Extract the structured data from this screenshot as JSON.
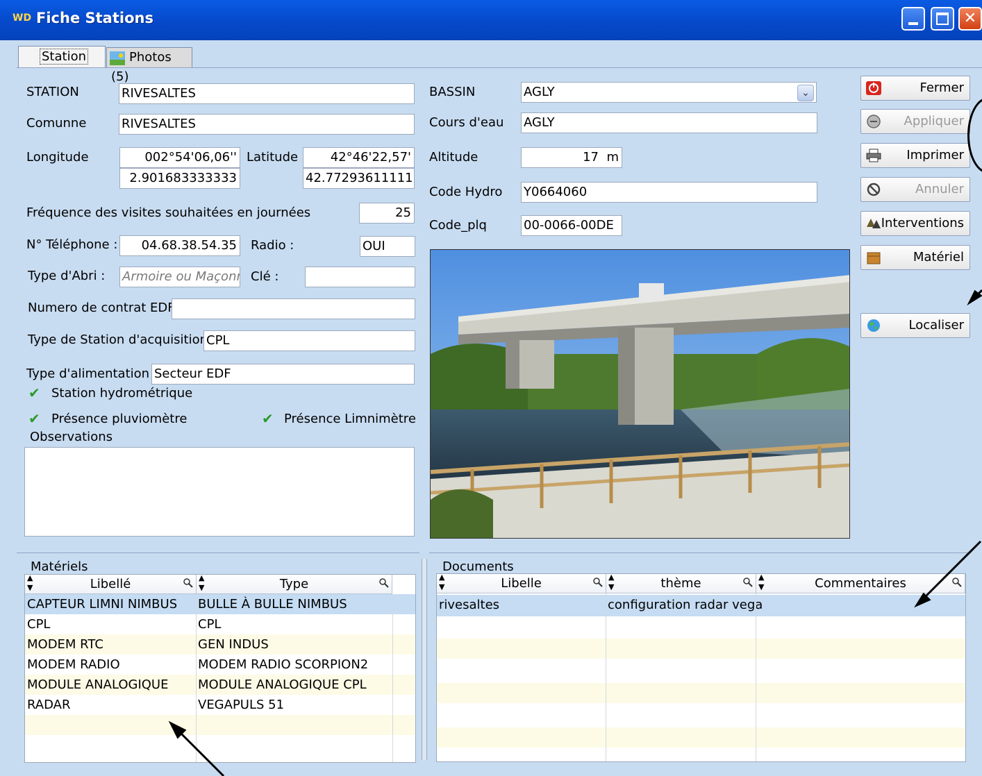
{
  "window": {
    "title": "Fiche Stations",
    "app_icon": "WD"
  },
  "tabs": [
    {
      "label": "Station"
    },
    {
      "label": "Photos (5)"
    }
  ],
  "form": {
    "station": {
      "label": "STATION",
      "value": "RIVESALTES"
    },
    "commune": {
      "label": "Comunne",
      "value": "RIVESALTES"
    },
    "longitude": {
      "label": "Longitude",
      "dms": "002°54'06,06''",
      "decimal": "2.901683333333"
    },
    "latitude": {
      "label": "Latitude",
      "dms": "42°46'22,57'",
      "decimal": "42.77293611111"
    },
    "frequence": {
      "label": "Fréquence des visites souhaitées en journées",
      "value": "25"
    },
    "telephone": {
      "label": "N° Téléphone :",
      "value": "04.68.38.54.35"
    },
    "radio": {
      "label": "Radio :",
      "value": "OUI"
    },
    "type_abri": {
      "label": "Type d'Abri :",
      "placeholder": "Armoire ou Maçonnerie"
    },
    "cle": {
      "label": "Clé :",
      "value": ""
    },
    "contrat_edf": {
      "label": "Numero de contrat EDF",
      "value": ""
    },
    "type_station": {
      "label": "Type de Station d'acquisition",
      "value": "CPL"
    },
    "type_alim": {
      "label": "Type d'alimentation :",
      "value": "Secteur EDF"
    },
    "checks": {
      "hydro": {
        "label": "Station hydrométrique",
        "checked": true
      },
      "pluvio": {
        "label": "Présence pluviomètre",
        "checked": true
      },
      "limni": {
        "label": "Présence Limnimètre",
        "checked": true
      }
    },
    "observations": {
      "label": "Observations",
      "value": ""
    },
    "bassin": {
      "label": "BASSIN",
      "value": "AGLY"
    },
    "cours_eau": {
      "label": "Cours d'eau",
      "value": "AGLY"
    },
    "altitude": {
      "label": "Altitude",
      "value": "17",
      "unit": "m"
    },
    "code_hydro": {
      "label": "Code Hydro",
      "value": "Y0664060"
    },
    "code_plq": {
      "label": "Code_plq",
      "value": "00-0066-00DE"
    }
  },
  "buttons": {
    "fermer": "Fermer",
    "appliquer": "Appliquer",
    "imprimer": "Imprimer",
    "annuler": "Annuler",
    "interventions": "Interventions",
    "materiel": "Matériel",
    "localiser": "Localiser"
  },
  "materiels": {
    "title": "Matériels",
    "columns": [
      "Libellé",
      "Type"
    ],
    "rows": [
      [
        "CAPTEUR LIMNI NIMBUS",
        "BULLE À BULLE NIMBUS"
      ],
      [
        "CPL",
        "CPL"
      ],
      [
        "MODEM RTC",
        "GEN INDUS"
      ],
      [
        "MODEM RADIO",
        "MODEM RADIO SCORPION2"
      ],
      [
        "MODULE ANALOGIQUE",
        "MODULE ANALOGIQUE CPL"
      ],
      [
        "RADAR",
        "VEGAPULS 51"
      ]
    ]
  },
  "documents": {
    "title": "Documents",
    "columns": [
      "Libelle",
      "thème",
      "Commentaires"
    ],
    "rows": [
      [
        "rivesaltes",
        "configuration radar vega",
        ""
      ]
    ]
  },
  "colors": {
    "titlebar": "#0548c9",
    "window_bg": "#c8dcf1",
    "row_selected": "#c5dcf3",
    "row_alt": "#fdfbe6",
    "check": "#2a9a2a"
  }
}
